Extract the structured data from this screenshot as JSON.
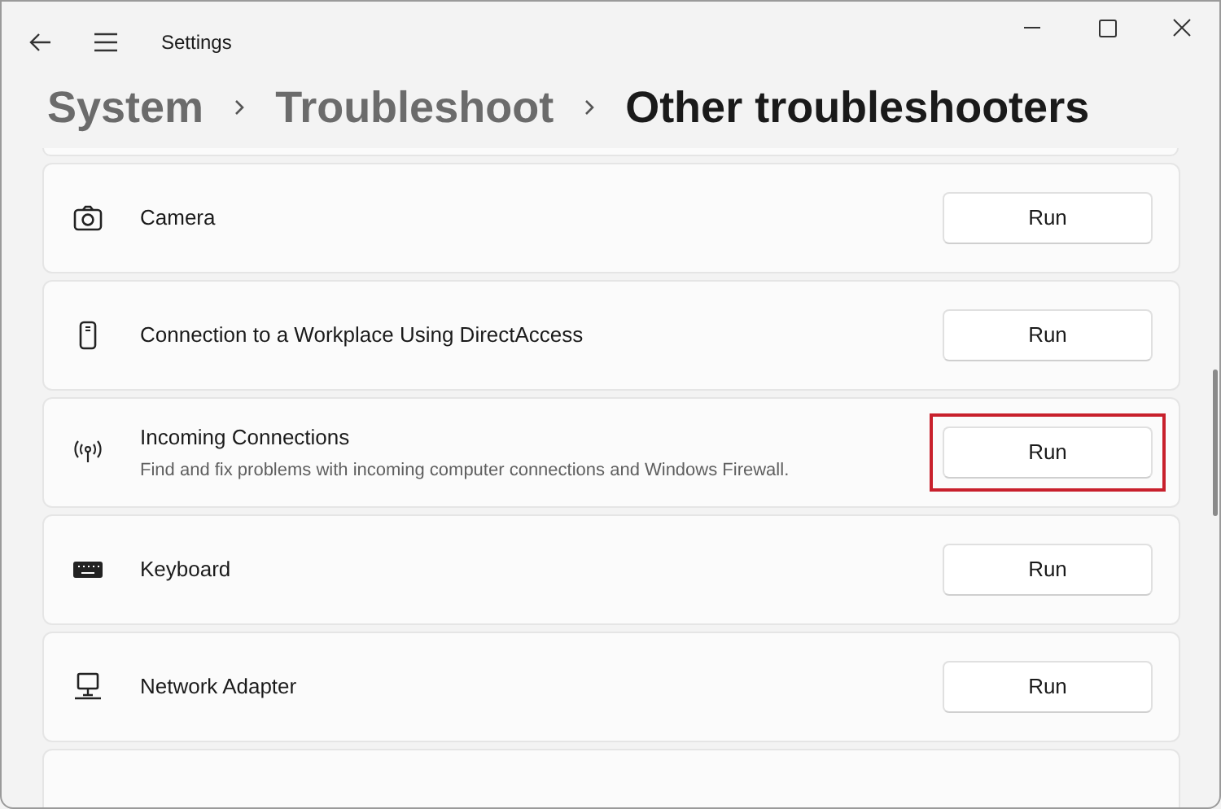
{
  "window": {
    "title": "Settings"
  },
  "breadcrumb": [
    {
      "label": "System",
      "current": false
    },
    {
      "label": "Troubleshoot",
      "current": false
    },
    {
      "label": "Other troubleshooters",
      "current": true
    }
  ],
  "troubleshooters": [
    {
      "kind": "camera",
      "title": "Camera",
      "button": "Run",
      "highlighted": false
    },
    {
      "kind": "device",
      "title": "Connection to a Workplace Using DirectAccess",
      "button": "Run",
      "highlighted": false
    },
    {
      "kind": "antenna",
      "title": "Incoming Connections",
      "description": "Find and fix problems with incoming computer connections and Windows Firewall.",
      "button": "Run",
      "highlighted": true
    },
    {
      "kind": "keyboard",
      "title": "Keyboard",
      "button": "Run",
      "highlighted": false
    },
    {
      "kind": "network",
      "title": "Network Adapter",
      "button": "Run",
      "highlighted": false
    },
    {
      "kind": "partial"
    }
  ]
}
